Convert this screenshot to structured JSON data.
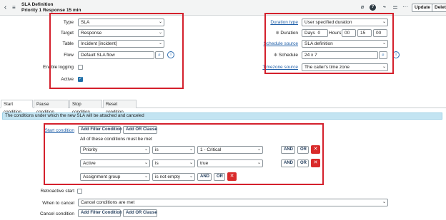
{
  "header": {
    "title": "SLA Definition",
    "subtitle": "Priority 1 Response 15 min",
    "icons": [
      "paperclip-icon",
      "help-icon",
      "activity-icon",
      "settings-sliders-icon",
      "more-icon"
    ],
    "update_label": "Update",
    "delete_label": "Delet"
  },
  "form_left": {
    "type": {
      "label": "Type",
      "value": "SLA"
    },
    "target": {
      "label": "Target",
      "value": "Response"
    },
    "table": {
      "label": "Table",
      "value": "Incident [incident]"
    },
    "flow": {
      "label": "Flow",
      "value": "Default SLA flow"
    },
    "enable_logging": {
      "label": "Enable logging",
      "checked": false
    },
    "active": {
      "label": "Active",
      "checked": true
    }
  },
  "form_right": {
    "duration_type": {
      "label": "Duration type",
      "value": "User specified duration"
    },
    "duration": {
      "label": "Duration",
      "days_label": "Days",
      "days_value": "0",
      "hours_label": "Hours",
      "hours_value": "00",
      "minutes_value": "15",
      "seconds_value": "00"
    },
    "schedule_source": {
      "label": "Schedule source",
      "value": "SLA definition"
    },
    "schedule": {
      "label": "Schedule",
      "value": "24 x 7"
    },
    "timezone_source": {
      "label": "Timezone source",
      "value": "The caller's time zone"
    }
  },
  "tabs": [
    "Start condition",
    "Pause condition",
    "Stop condition",
    "Reset condition"
  ],
  "banner": "The conditions under which the new SLA will be attached and canceled",
  "start_condition": {
    "label": "Start condition",
    "add_filter_label": "Add Filter Condition",
    "add_or_label": "Add OR Clause",
    "all_conditions_text": "All of these conditions must be met",
    "rows": [
      {
        "field": "Priority",
        "operator": "is",
        "value": "1 - Critical"
      },
      {
        "field": "Active",
        "operator": "is",
        "value": "true"
      },
      {
        "field": "Assignment group",
        "operator": "is not empty",
        "value": ""
      }
    ],
    "and_label": "AND",
    "or_label": "OR",
    "remove_label": "✕"
  },
  "retroactive_start": {
    "label": "Retroactive start",
    "checked": false
  },
  "when_to_cancel": {
    "label": "When to cancel",
    "value": "Cancel conditions are met"
  },
  "cancel_condition": {
    "label": "Cancel condition",
    "add_filter_label": "Add Filter Condition",
    "add_or_label": "Add OR Clause"
  },
  "colors": {
    "highlight_box": "#d4202c",
    "banner": "#c3e4f2",
    "remove_button": "#d92b2b",
    "link": "#1f5fa8"
  }
}
